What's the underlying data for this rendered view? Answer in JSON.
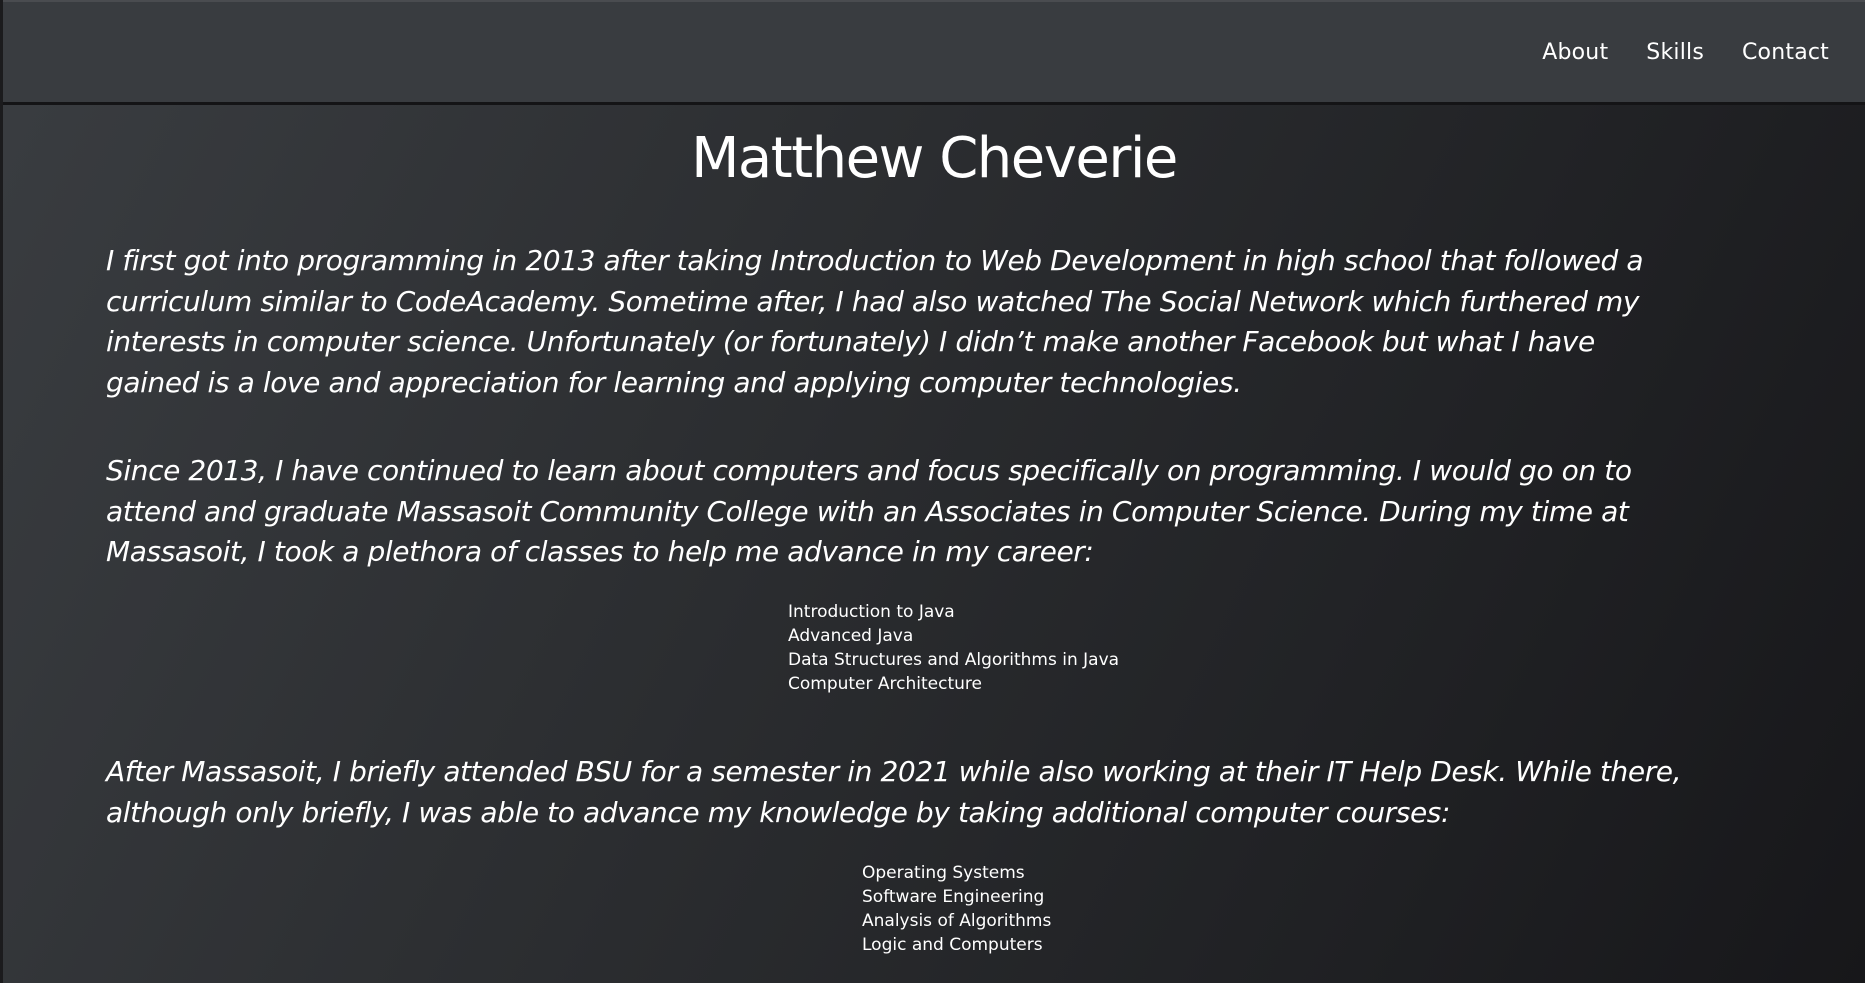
{
  "nav": {
    "items": [
      {
        "label": "About"
      },
      {
        "label": "Skills"
      },
      {
        "label": "Contact"
      }
    ]
  },
  "main": {
    "title": "Matthew Cheverie",
    "paragraph1": "I first got into programming in 2013 after taking Introduction to Web Development in high school that followed a\ncurriculum similar to CodeAcademy. Sometime after, I had also watched The Social Network which furthered my\ninterests in computer science. Unfortunately (or fortunately) I didn’t make another Facebook but what I have\ngained is a love and appreciation for learning and applying computer technologies.",
    "paragraph2": "Since 2013, I have continued to learn about computers and focus specifically on programming. I would go on to\nattend and graduate Massasoit Community College with an Associates in Computer Science. During my time at\nMassasoit, I took a plethora of classes to help me advance in my career:",
    "massasoit_courses": [
      "Introduction to Java",
      "Advanced Java",
      "Data Structures and Algorithms in Java",
      "Computer Architecture"
    ],
    "paragraph3": "After Massasoit, I briefly attended BSU for a semester in 2021 while also working at their IT Help Desk. While there,\nalthough only briefly, I was able to advance my knowledge by taking additional computer courses:",
    "bsu_courses": [
      "Operating Systems",
      "Software Engineering",
      "Analysis of Algorithms",
      "Logic and Computers"
    ]
  }
}
